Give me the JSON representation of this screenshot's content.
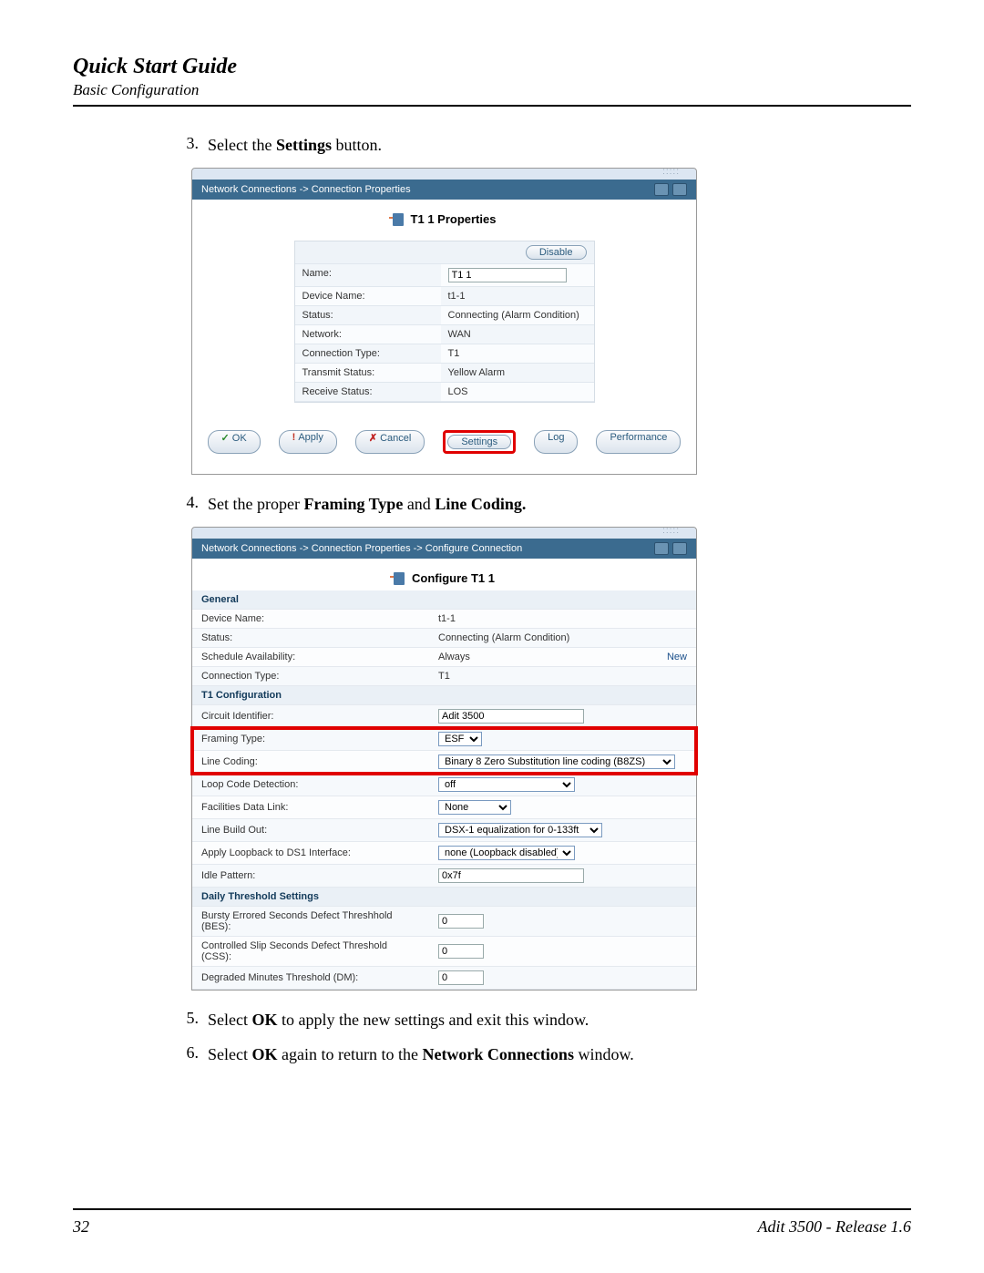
{
  "header": {
    "title": "Quick Start Guide",
    "subtitle": "Basic Configuration"
  },
  "steps": {
    "s3_num": "3.",
    "s3_a": "Select the ",
    "s3_b": "Settings",
    "s3_c": " button.",
    "s4_num": "4.",
    "s4_a": "Set the proper ",
    "s4_b": "Framing Type",
    "s4_c": " and ",
    "s4_d": "Line Coding.",
    "s5_num": "5.",
    "s5_a": "Select ",
    "s5_b": "OK",
    "s5_c": " to apply the new settings and exit this window.",
    "s6_num": "6.",
    "s6_a": "Select ",
    "s6_b": "OK",
    "s6_c": " again to return to the ",
    "s6_d": "Network Connections",
    "s6_e": " window."
  },
  "ss1": {
    "breadcrumb": "Network Connections -> Connection Properties",
    "title": "T1 1 Properties",
    "disable": "Disable",
    "rows": {
      "name_l": "Name:",
      "name_v": "T1 1",
      "dev_l": "Device Name:",
      "dev_v": "t1-1",
      "status_l": "Status:",
      "status_v": "Connecting (Alarm Condition)",
      "net_l": "Network:",
      "net_v": "WAN",
      "ctype_l": "Connection Type:",
      "ctype_v": "T1",
      "tx_l": "Transmit Status:",
      "tx_v": "Yellow Alarm",
      "rx_l": "Receive Status:",
      "rx_v": "LOS"
    },
    "buttons": {
      "ok": "OK",
      "apply": "Apply",
      "cancel": "Cancel",
      "settings": "Settings",
      "log": "Log",
      "performance": "Performance"
    }
  },
  "ss2": {
    "breadcrumb": "Network Connections -> Connection Properties -> Configure Connection",
    "title": "Configure T1 1",
    "sections": {
      "general": "General",
      "t1cfg": "T1 Configuration",
      "daily": "Daily Threshold Settings"
    },
    "rows": {
      "dev_l": "Device Name:",
      "dev_v": "t1-1",
      "status_l": "Status:",
      "status_v": "Connecting (Alarm Condition)",
      "sched_l": "Schedule Availability:",
      "sched_v": "Always",
      "sched_new": "New",
      "ctype_l": "Connection Type:",
      "ctype_v": "T1",
      "cid_l": "Circuit Identifier:",
      "cid_v": "Adit 3500",
      "frame_l": "Framing Type:",
      "frame_v": "ESF",
      "linec_l": "Line Coding:",
      "linec_v": "Binary 8 Zero Substitution line coding (B8ZS)",
      "loop_l": "Loop Code Detection:",
      "loop_v": "off",
      "fdl_l": "Facilities Data Link:",
      "fdl_v": "None",
      "lbo_l": "Line Build Out:",
      "lbo_v": "DSX-1 equalization for 0-133ft",
      "alb_l": "Apply Loopback to DS1 Interface:",
      "alb_v": "none (Loopback disabled)",
      "idle_l": "Idle Pattern:",
      "idle_v": "0x7f",
      "bes_l": "Bursty Errored Seconds Defect Threshhold (BES):",
      "bes_v": "0",
      "css_l": "Controlled Slip Seconds Defect Threshold (CSS):",
      "css_v": "0",
      "dm_l": "Degraded Minutes Threshold (DM):",
      "dm_v": "0"
    }
  },
  "footer": {
    "page": "32",
    "product": "Adit 3500  - Release 1.6"
  }
}
